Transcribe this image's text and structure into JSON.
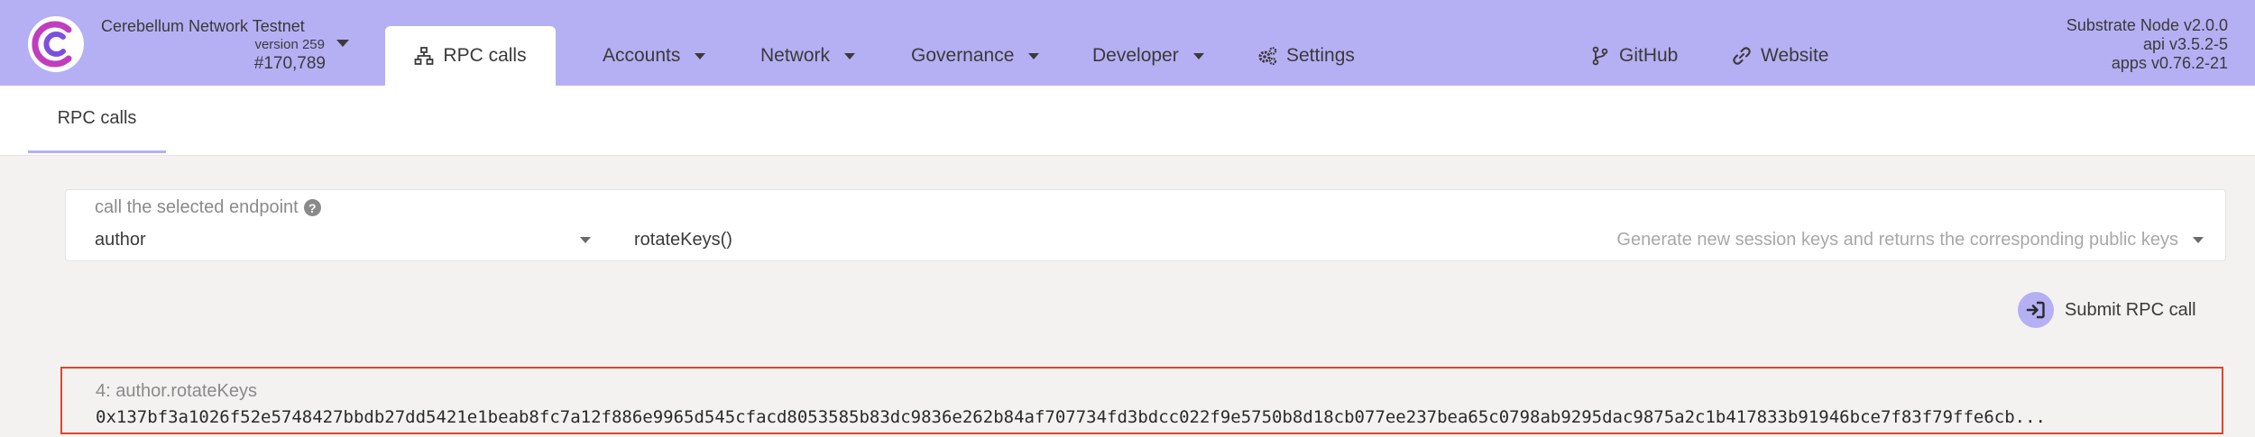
{
  "header": {
    "chain_name": "Cerebellum Network Testnet",
    "version": "version 259",
    "block": "#170,789",
    "logo_icon": "cere-logo-icon",
    "nav": {
      "active": {
        "label": "RPC calls",
        "icon": "network-tree-icon"
      },
      "items": [
        {
          "label": "Accounts",
          "dropdown": true
        },
        {
          "label": "Network",
          "dropdown": true
        },
        {
          "label": "Governance",
          "dropdown": true
        },
        {
          "label": "Developer",
          "dropdown": true
        },
        {
          "label": "Settings",
          "icon": "gears-icon"
        }
      ],
      "links": [
        {
          "label": "GitHub",
          "icon": "code-branch-icon"
        },
        {
          "label": "Website",
          "icon": "link-icon"
        }
      ]
    },
    "node": {
      "name": "Substrate Node v2.0.0",
      "api": "api v3.5.2-5",
      "apps": "apps v0.76.2-21"
    }
  },
  "subtabs": [
    {
      "label": "RPC calls",
      "active": true
    }
  ],
  "form": {
    "label": "call the selected endpoint",
    "section": "author",
    "method": "rotateKeys()",
    "method_description": "Generate new session keys and returns the corresponding public keys"
  },
  "submit": {
    "label": "Submit RPC call",
    "icon": "sign-in-icon"
  },
  "result": {
    "label": "4: author.rotateKeys",
    "value": "0x137bf3a1026f52e5748427bbdb27dd5421e1beab8fc7a12f886e9965d545cfacd8053585b83dc9836e262b84af707734fd3bdcc022f9e5750b8d18cb077ee237bea65c0798ab9295dac9875a2c1b417833b91946bce7f83f79ffe6cb..."
  },
  "colors": {
    "accent": "#b5b0f4",
    "highlight_border": "#e0442e",
    "background": "#f3f2f1"
  }
}
